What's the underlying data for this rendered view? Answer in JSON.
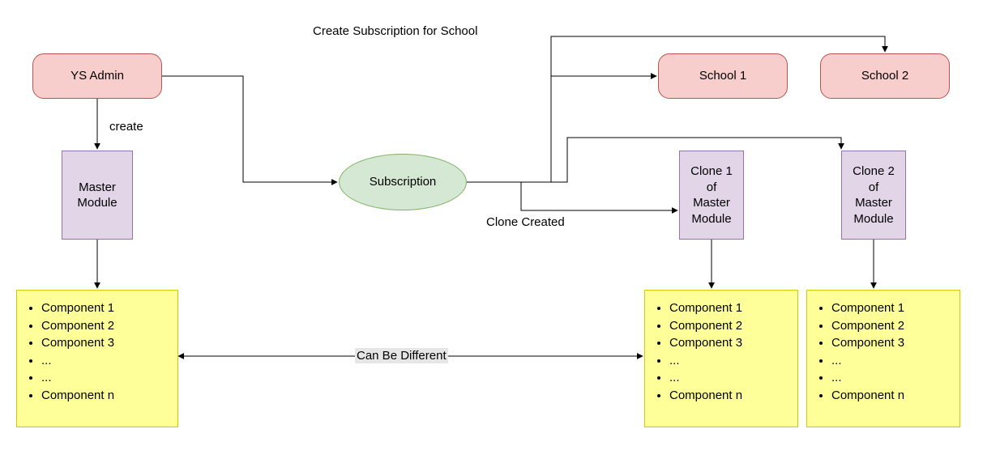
{
  "nodes": {
    "admin": {
      "label": "YS Admin"
    },
    "master": {
      "label": "Master Module"
    },
    "sub": {
      "label": "Subscription"
    },
    "school1": {
      "label": "School 1"
    },
    "school2": {
      "label": "School 2"
    },
    "clone1": {
      "label": "Clone 1\nof\nMaster\nModule"
    },
    "clone2": {
      "label": "Clone 2\nof\nMaster\nModule"
    }
  },
  "labels": {
    "createSub": "Create Subscription for School",
    "create": "create",
    "cloneCreated": "Clone Created",
    "canDiff": "Can Be Different"
  },
  "components": {
    "master": [
      "Component 1",
      "Component 2",
      "Component 3",
      "...",
      "...",
      "Component n"
    ],
    "clone1": [
      "Component 1",
      "Component 2",
      "Component 3",
      "...",
      "...",
      "Component n"
    ],
    "clone2": [
      "Component 1",
      "Component 2",
      "Component 3",
      "...",
      "...",
      "Component n"
    ]
  },
  "colors": {
    "pinkFill": "#f8cecc",
    "pinkStroke": "#b85450",
    "purpleFill": "#e1d5e7",
    "purpleStroke": "#9673a6",
    "yellowFill": "#ffff99",
    "yellowStroke": "#cccc00",
    "greenFill": "#d5e8d4",
    "greenStroke": "#82b366"
  }
}
